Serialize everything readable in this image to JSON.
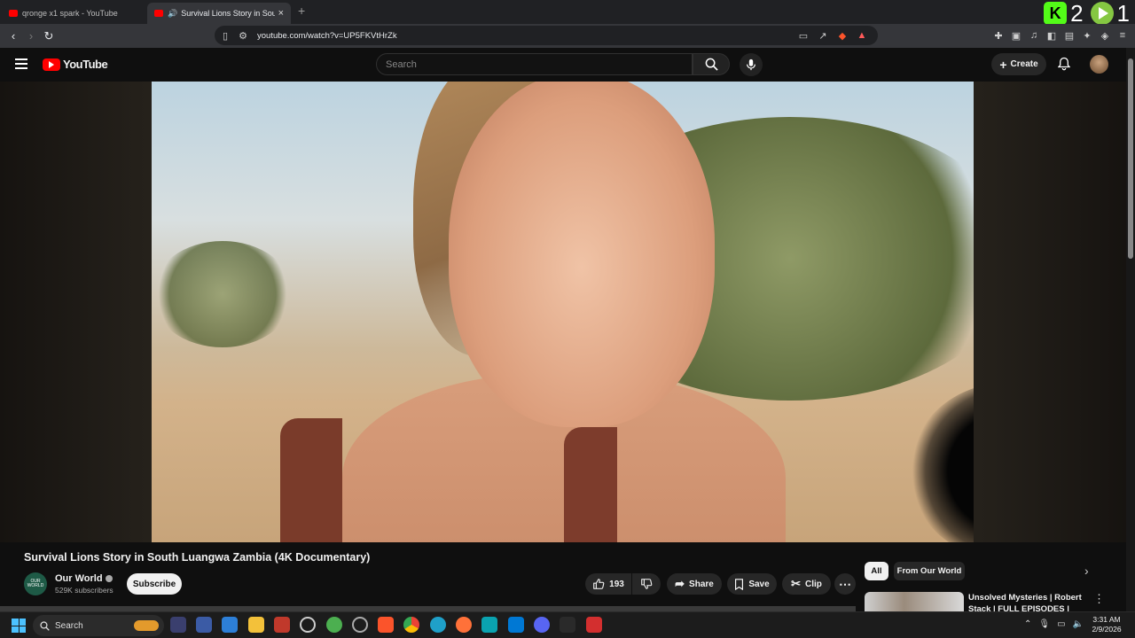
{
  "browser": {
    "tabs": [
      {
        "title": "qronge x1 spark - YouTube",
        "active": false
      },
      {
        "title": "Survival Lions Story in South",
        "active": true
      }
    ],
    "url": "youtube.com/watch?v=UP5FKVtHrZk",
    "overlay_counts": {
      "kick": "2",
      "rumble": "1"
    }
  },
  "youtube": {
    "logo_text": "YouTube",
    "search_placeholder": "Search",
    "create_label": "Create"
  },
  "video": {
    "title": "Survival Lions Story in South Luangwa Zambia (4K Documentary)",
    "channel": {
      "name": "Our World",
      "avatar_text": "OUR WORLD",
      "subscribers": "529K subscribers"
    },
    "subscribe_label": "Subscribe",
    "actions": {
      "likes": "193",
      "share": "Share",
      "save": "Save",
      "clip": "Clip"
    }
  },
  "sidebar": {
    "chips": [
      "All",
      "From Our World"
    ],
    "recommended": [
      {
        "title": "Unsolved Mysteries | Robert Stack | FULL EPISODES |"
      }
    ]
  },
  "taskbar": {
    "search_label": "Search",
    "time": "3:31 AM",
    "date": "2/9/2026"
  },
  "colors": {
    "yt_red": "#ff0000",
    "kick_green": "#53fc18",
    "rumble_green": "#85c742",
    "background": "#0f0f0f"
  }
}
